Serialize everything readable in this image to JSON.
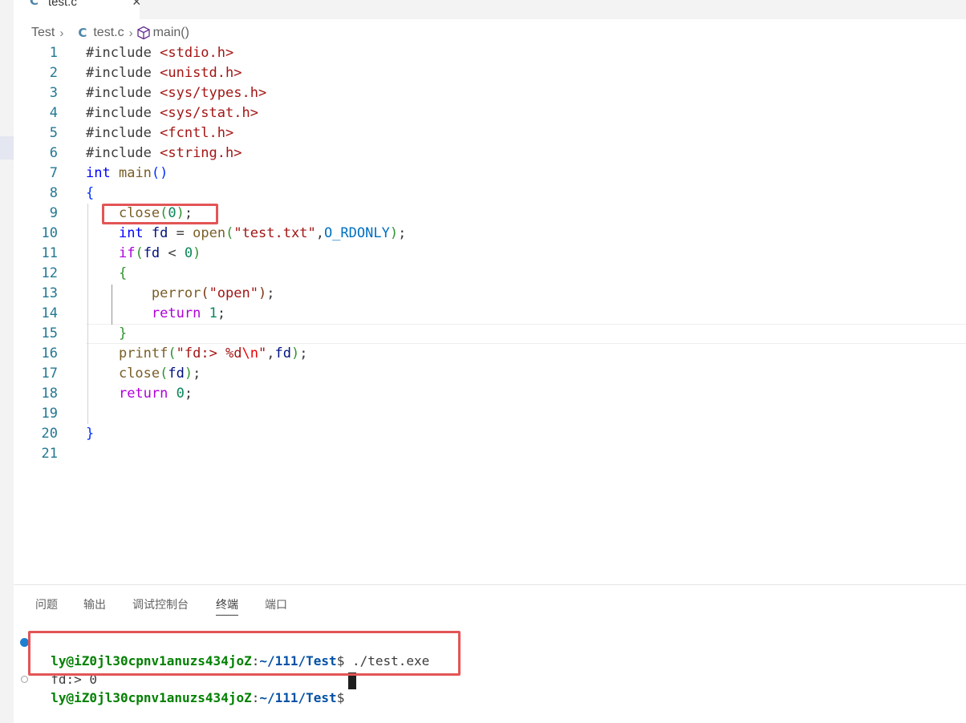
{
  "tab": {
    "icon": "c-language-icon",
    "label": "test.c",
    "close_icon": "close-icon"
  },
  "breadcrumb": {
    "folder": "Test",
    "file": "test.c",
    "symbol": "main()"
  },
  "editor": {
    "lines": [
      {
        "n": "1",
        "tokens": [
          [
            "pp",
            "#include "
          ],
          [
            "inc",
            "<stdio.h>"
          ]
        ]
      },
      {
        "n": "2",
        "tokens": [
          [
            "pp",
            "#include "
          ],
          [
            "inc",
            "<unistd.h>"
          ]
        ]
      },
      {
        "n": "3",
        "tokens": [
          [
            "pp",
            "#include "
          ],
          [
            "inc",
            "<sys/types.h>"
          ]
        ]
      },
      {
        "n": "4",
        "tokens": [
          [
            "pp",
            "#include "
          ],
          [
            "inc",
            "<sys/stat.h>"
          ]
        ]
      },
      {
        "n": "5",
        "tokens": [
          [
            "pp",
            "#include "
          ],
          [
            "inc",
            "<fcntl.h>"
          ]
        ]
      },
      {
        "n": "6",
        "tokens": [
          [
            "pp",
            "#include "
          ],
          [
            "inc",
            "<string.h>"
          ]
        ]
      },
      {
        "n": "7",
        "tokens": [
          [
            "type",
            "int"
          ],
          [
            "pp",
            " "
          ],
          [
            "fn",
            "main"
          ],
          [
            "p1",
            "()"
          ]
        ]
      },
      {
        "n": "8",
        "tokens": [
          [
            "p1",
            "{"
          ]
        ]
      },
      {
        "n": "9",
        "tokens": [
          [
            "pp",
            "    "
          ],
          [
            "fn",
            "close"
          ],
          [
            "p2",
            "("
          ],
          [
            "num",
            "0"
          ],
          [
            "p2",
            ")"
          ],
          [
            "pp",
            ";"
          ]
        ]
      },
      {
        "n": "10",
        "tokens": [
          [
            "pp",
            "    "
          ],
          [
            "type",
            "int"
          ],
          [
            "pp",
            " "
          ],
          [
            "var",
            "fd"
          ],
          [
            "pp",
            " = "
          ],
          [
            "fn",
            "open"
          ],
          [
            "p2",
            "("
          ],
          [
            "str",
            "\"test.txt\""
          ],
          [
            "pp",
            ","
          ],
          [
            "macro",
            "O_RDONLY"
          ],
          [
            "p2",
            ")"
          ],
          [
            "pp",
            ";"
          ]
        ]
      },
      {
        "n": "11",
        "tokens": [
          [
            "pp",
            "    "
          ],
          [
            "ctl",
            "if"
          ],
          [
            "p2",
            "("
          ],
          [
            "var",
            "fd"
          ],
          [
            "pp",
            " < "
          ],
          [
            "num",
            "0"
          ],
          [
            "p2",
            ")"
          ]
        ]
      },
      {
        "n": "12",
        "tokens": [
          [
            "pp",
            "    "
          ],
          [
            "p2",
            "{"
          ]
        ]
      },
      {
        "n": "13",
        "tokens": [
          [
            "pp",
            "        "
          ],
          [
            "fn",
            "perror"
          ],
          [
            "p3",
            "("
          ],
          [
            "str",
            "\"open\""
          ],
          [
            "p3",
            ")"
          ],
          [
            "pp",
            ";"
          ]
        ]
      },
      {
        "n": "14",
        "tokens": [
          [
            "pp",
            "        "
          ],
          [
            "ctl",
            "return"
          ],
          [
            "pp",
            " "
          ],
          [
            "num",
            "1"
          ],
          [
            "pp",
            ";"
          ]
        ]
      },
      {
        "n": "15",
        "tokens": [
          [
            "pp",
            "    "
          ],
          [
            "p2",
            "}"
          ]
        ]
      },
      {
        "n": "16",
        "tokens": [
          [
            "pp",
            "    "
          ],
          [
            "fn",
            "printf"
          ],
          [
            "p2",
            "("
          ],
          [
            "str",
            "\"fd:> %d"
          ],
          [
            "esc",
            "\\n"
          ],
          [
            "str",
            "\""
          ],
          [
            "pp",
            ","
          ],
          [
            "var",
            "fd"
          ],
          [
            "p2",
            ")"
          ],
          [
            "pp",
            ";"
          ]
        ]
      },
      {
        "n": "17",
        "tokens": [
          [
            "pp",
            "    "
          ],
          [
            "fn",
            "close"
          ],
          [
            "p2",
            "("
          ],
          [
            "var",
            "fd"
          ],
          [
            "p2",
            ")"
          ],
          [
            "pp",
            ";"
          ]
        ]
      },
      {
        "n": "18",
        "tokens": [
          [
            "pp",
            "    "
          ],
          [
            "ctl",
            "return"
          ],
          [
            "pp",
            " "
          ],
          [
            "num",
            "0"
          ],
          [
            "pp",
            ";"
          ]
        ]
      },
      {
        "n": "19",
        "tokens": []
      },
      {
        "n": "20",
        "tokens": [
          [
            "p1",
            "}"
          ]
        ]
      },
      {
        "n": "21",
        "tokens": []
      }
    ]
  },
  "panel": {
    "tabs": [
      "问题",
      "输出",
      "调试控制台",
      "终端",
      "端口"
    ],
    "active_tab": "终端"
  },
  "terminal": {
    "line1": {
      "user": "ly@iZ0jl30cpnv1anuzs434joZ",
      "sep": ":",
      "path": "~/111/Test",
      "prompt": "$ ",
      "cmd": "./test.exe"
    },
    "line2": "fd:> 0",
    "line3": {
      "user": "ly@iZ0jl30cpnv1anuzs434joZ",
      "sep": ":",
      "path": "~/111/Test",
      "prompt": "$ "
    }
  },
  "colors": {
    "highlight_box": "#e35556",
    "accent": "#1f7fd1"
  }
}
